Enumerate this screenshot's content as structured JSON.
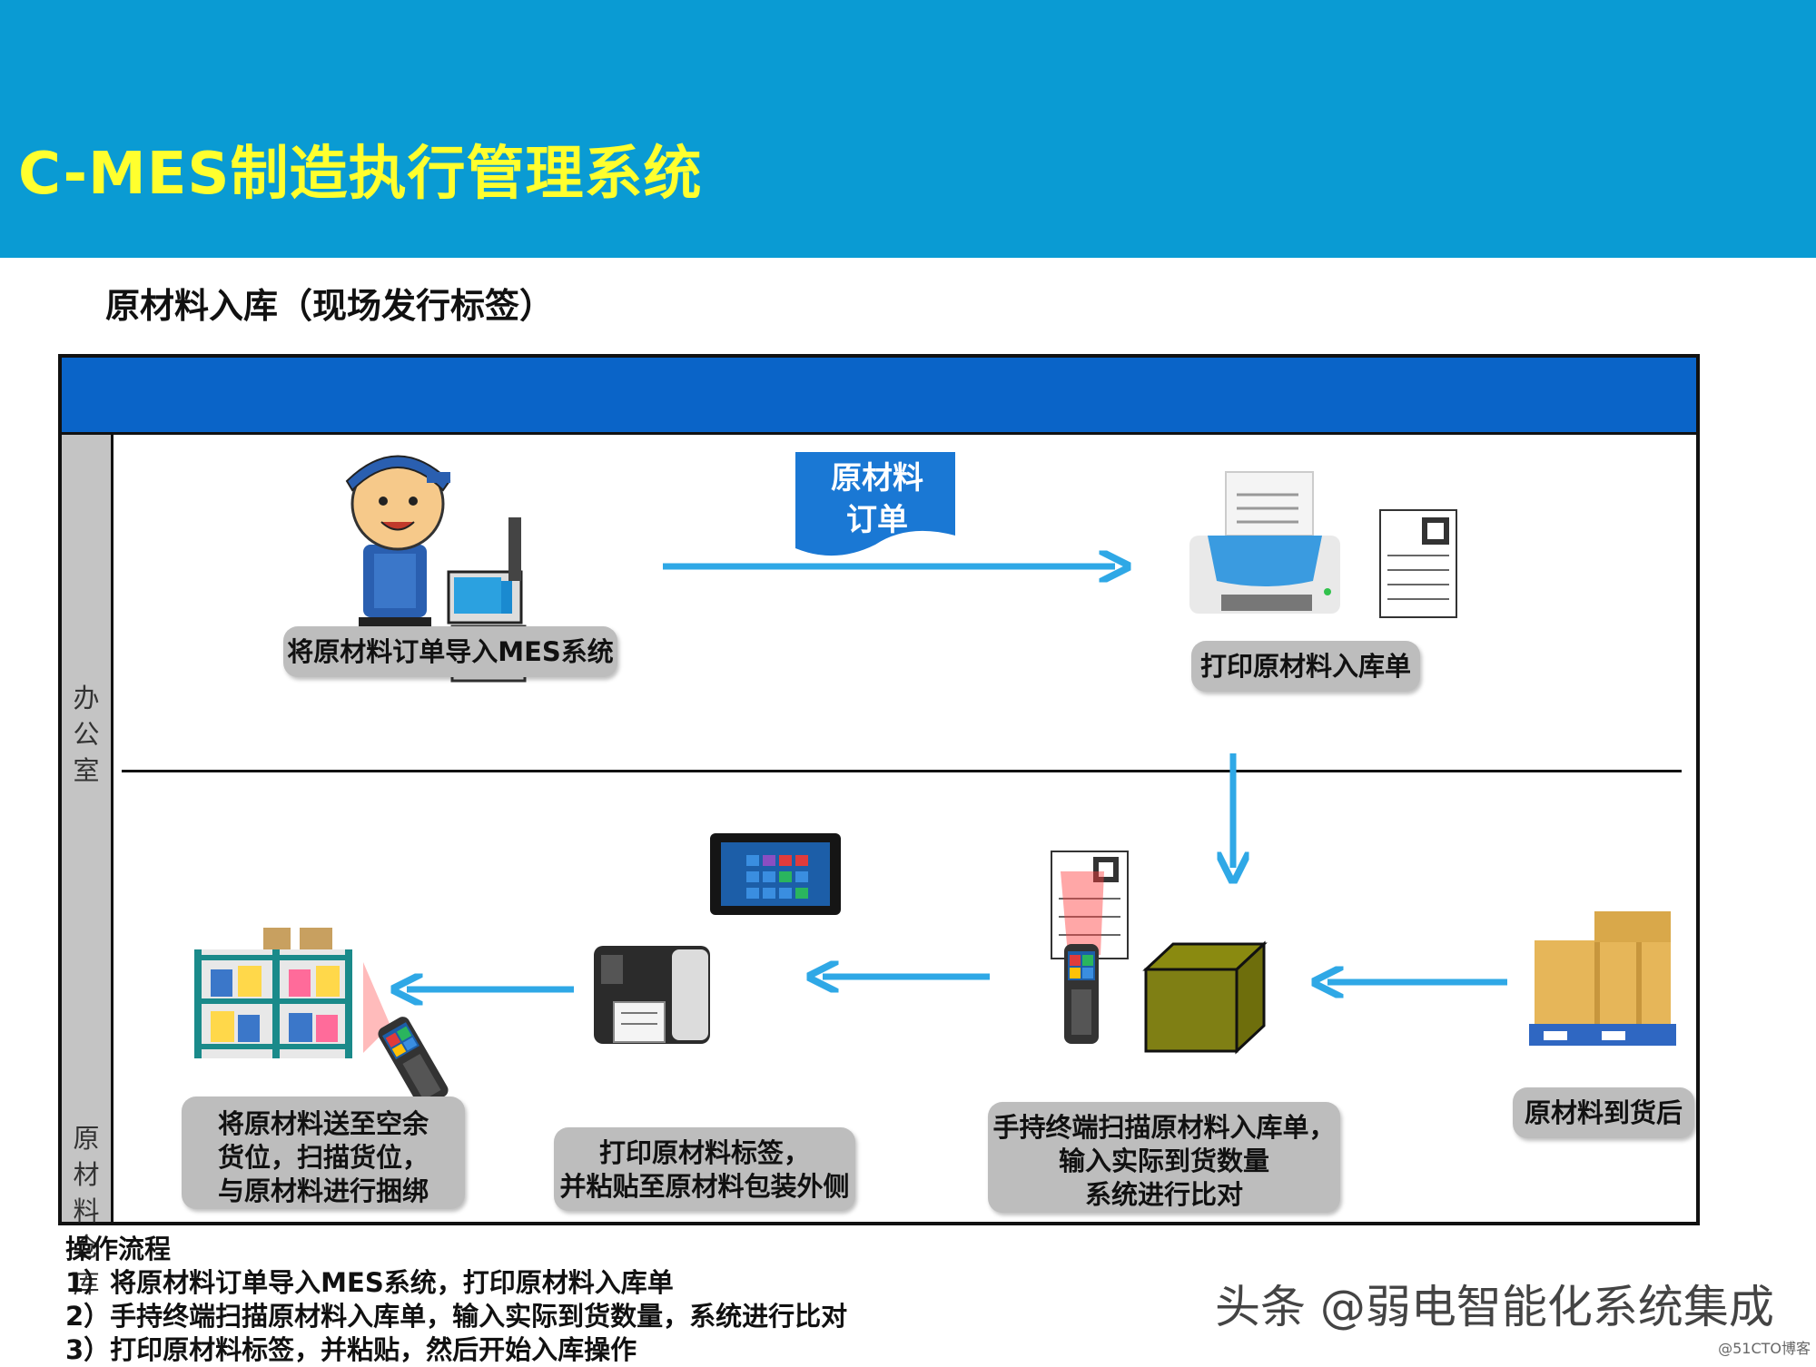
{
  "header": {
    "title": "C-MES制造执行管理系统"
  },
  "section": {
    "title": "原材料入库（现场发行标签）"
  },
  "lanes": {
    "office": "办公室",
    "warehouse": "原材料仓库"
  },
  "document_label": {
    "line1": "原材料",
    "line2": "订单"
  },
  "steps": {
    "import_orders": "将原材料订单导入MES系统",
    "print_receipt": "打印原材料入库单",
    "arrival": "原材料到货后",
    "scan_compare": {
      "line1": "手持终端扫描原材料入库单，",
      "line2": "输入实际到货数量",
      "line3": "系统进行比对"
    },
    "print_label": {
      "line1": "打印原材料标签，",
      "line2": "并粘贴至原材料包装外侧"
    },
    "bind_location": {
      "line1": "将原材料送至空余",
      "line2": "货位，扫描货位，",
      "line3": "与原材料进行捆绑"
    }
  },
  "procedure": {
    "title": "操作流程",
    "items": [
      "1）将原材料订单导入MES系统，打印原材料入库单",
      "2）手持终端扫描原材料入库单，输入实际到货数量，系统进行比对",
      "3）打印原材料标签，并粘贴，然后开始入库操作"
    ]
  },
  "watermark": "头条 @弱电智能化系统集成",
  "credit": "@51CTO博客",
  "colors": {
    "header_bg": "#0a9bd3",
    "header_title": "#ffff2e",
    "frame_band": "#0a64c8",
    "arrow": "#2fa8e6",
    "pill_bg": "#bdbdbd"
  }
}
